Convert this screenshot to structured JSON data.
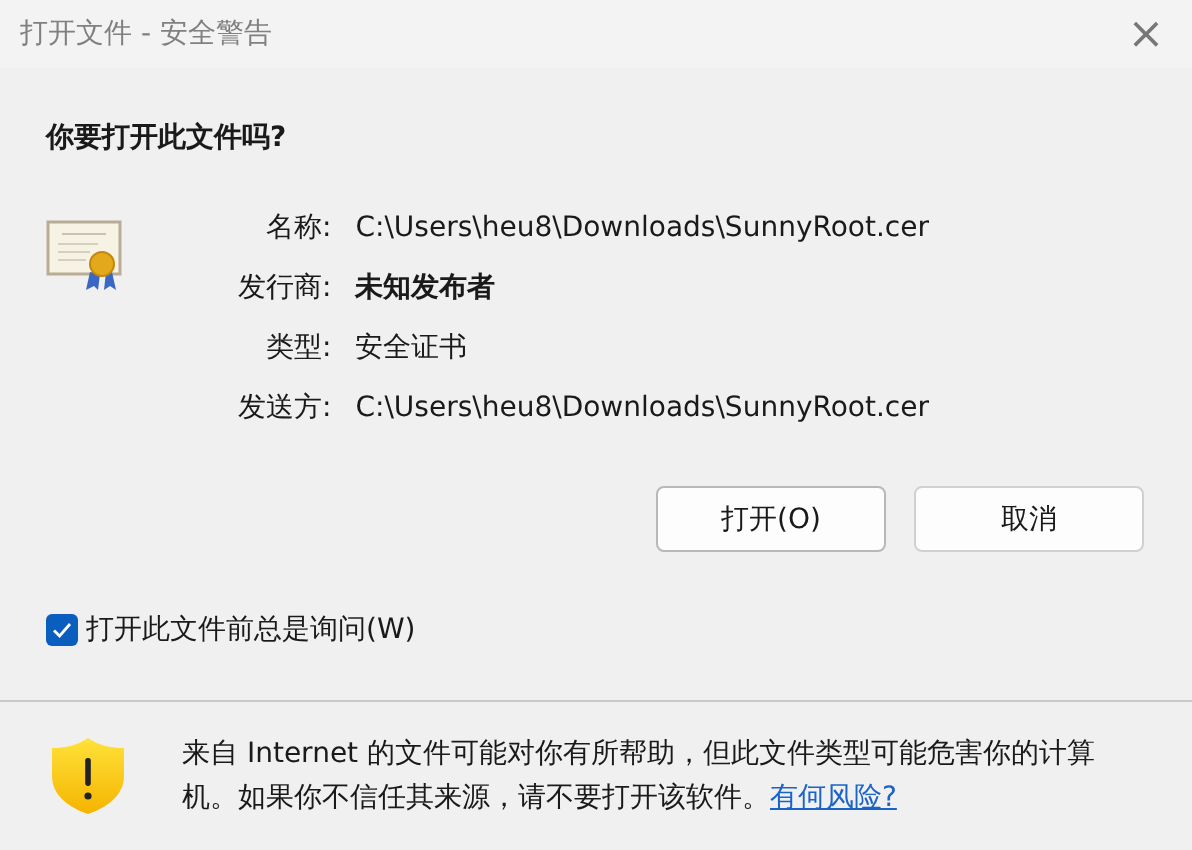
{
  "window": {
    "title": "打开文件 - 安全警告",
    "close": "×"
  },
  "question": "你要打开此文件吗?",
  "details": [
    {
      "label": "名称:",
      "value": "C:\\Users\\heu8\\Downloads\\SunnyRoot.cer",
      "emphasized": false
    },
    {
      "label": "发行商:",
      "value": "未知发布者",
      "emphasized": true
    },
    {
      "label": "类型:",
      "value": "安全证书",
      "emphasized": false
    },
    {
      "label": "发送方:",
      "value": "C:\\Users\\heu8\\Downloads\\SunnyRoot.cer",
      "emphasized": false
    }
  ],
  "buttons": [
    {
      "label": "打开(O)",
      "selected": true
    },
    {
      "label": "取消",
      "selected": false
    }
  ],
  "checkbox": {
    "label": "打开此文件前总是询问(W)",
    "checked": true
  },
  "warning": {
    "text": "来自 Internet 的文件可能对你有所帮助，但此文件类型可能危害你的计算机。如果你不信任其来源，请不要打开该软件。",
    "link": "有何风险?"
  }
}
